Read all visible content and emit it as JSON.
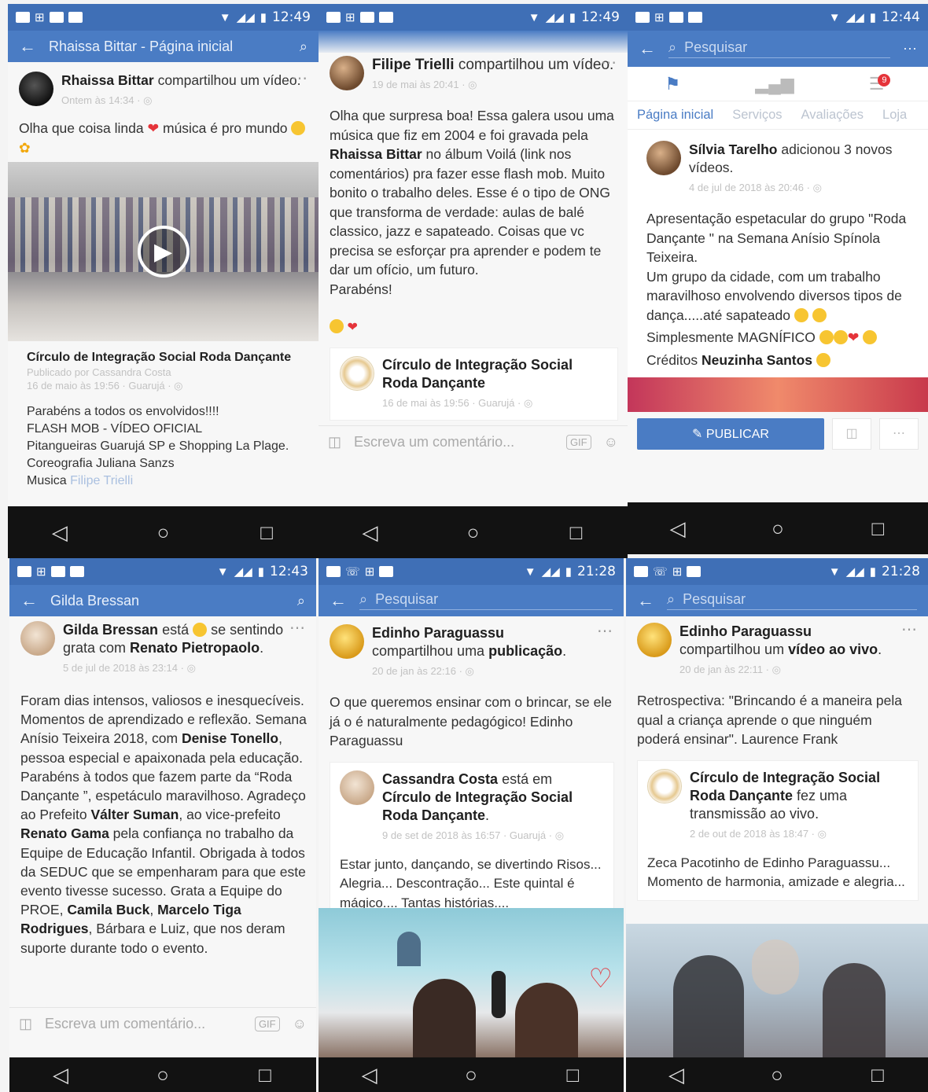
{
  "status": {
    "s1": {
      "time": "12:49",
      "battery": "43"
    },
    "s2": {
      "time": "12:49",
      "battery": "43"
    },
    "s3": {
      "time": "12:44",
      "battery": "46"
    },
    "s4": {
      "time": "12:43",
      "battery": "46"
    },
    "s5": {
      "time": "21:28",
      "battery": "40"
    },
    "s6": {
      "time": "21:28",
      "battery": "40"
    }
  },
  "screen1": {
    "appbar_title": "Rhaissa Bittar - Página inicial",
    "post": {
      "author": "Rhaissa Bittar",
      "action": "compartilhou um vídeo.",
      "time": "Ontem às 14:34 · ",
      "text_a": "Olha que coisa linda ",
      "text_b": " música é pro mundo"
    },
    "shared": {
      "title": "Círculo de Integração Social Roda Dançante",
      "published_by": "Publicado por Cassandra Costa",
      "time": "16 de maio às 19:56 · Guarujá · ",
      "lines": [
        "Parabéns a todos os envolvidos!!!!",
        "FLASH MOB - VÍDEO OFICIAL",
        "Pitangueiras Guarujá SP e Shopping La Plage.",
        "Coreografia Juliana Sanzs"
      ],
      "music_label": "Musica ",
      "music_link": "Filipe Trielli"
    }
  },
  "screen2": {
    "post": {
      "author": "Filipe Trielli",
      "action": "compartilhou um vídeo.",
      "time": "19 de mai às 20:41 · ",
      "text_a": "Olha que surpresa boa! Essa galera usou uma música que fiz em 2004 e foi gravada pela ",
      "text_bold": "Rhaissa Bittar",
      "text_b": " no álbum Voilá (link nos comentários) pra fazer esse flash mob. Muito bonito o trabalho deles. Esse é o tipo de ONG que transforma de verdade: aulas de balé classico, jazz e sapateado. Coisas que vc precisa se esforçar pra aprender e podem te dar um ofício, um futuro.",
      "text_c": "Parabéns!"
    },
    "shared": {
      "title": "Círculo de Integração Social Roda Dançante",
      "time": "16 de mai às 19:56 · Guarujá · "
    },
    "comment_placeholder": "Escreva um comentário...",
    "gif": "GIF"
  },
  "screen3": {
    "search_placeholder": "Pesquisar",
    "badge": "9",
    "tabs": [
      "Página inicial",
      "Serviços",
      "Avaliações",
      "Loja"
    ],
    "post": {
      "author": "Sílvia Tarelho",
      "action": "adicionou 3 novos vídeos.",
      "time": "4 de jul de 2018 às 20:46 · ",
      "p1": "Apresentação espetacular do grupo \"Roda Dançante \" na Semana Anísio Spínola Teixeira.",
      "p2": "Um grupo da cidade, com um trabalho maravilhoso envolvendo diversos tipos de dança.....até  sapateado",
      "p3": "Simplesmente  MAGNÍFICO",
      "credits_label": "Créditos  ",
      "credits_name": "Neuzinha Santos"
    },
    "publish": "PUBLICAR"
  },
  "screen4": {
    "appbar_title": "Gilda Bressan",
    "post": {
      "author": "Gilda Bressan",
      "action_a": "está ",
      "action_b": " se sentindo grata com ",
      "with": "Renato Pietropaolo",
      "time": "5 de jul de 2018 às 23:14 · ",
      "t1": "Foram dias intensos, valiosos e inesquecíveis. Momentos de aprendizado e reflexão. Semana Anísio Teixeira 2018, com ",
      "b1": "Denise Tonello",
      "t2": ", pessoa especial e apaixonada pela educação. Parabéns à todos que fazem parte da “Roda Dançante ”, espetáculo maravilhoso. Agradeço ao Prefeito ",
      "b2": "Válter Suman",
      "t3": ", ao vice-prefeito ",
      "b3": "Renato Gama",
      "t4": " pela confiança no trabalho da Equipe de Educação Infantil. Obrigada à todos da SEDUC que se empenharam para que este evento tivesse sucesso. Grata a Equipe do PROE, ",
      "b4": "Camila Buck",
      "t5": ", ",
      "b5": "Marcelo Tiga Rodrigues",
      "t6": ", Bárbara e Luiz, que nos deram suporte durante todo o evento."
    },
    "comment_placeholder": "Escreva um comentário...",
    "gif": "GIF"
  },
  "screen5": {
    "search_placeholder": "Pesquisar",
    "post": {
      "author": "Edinho Paraguassu",
      "action_a": "compartilhou uma ",
      "action_b": "publicação",
      "action_c": ".",
      "time": "20 de jan às 22:16 · ",
      "text": "O que queremos ensinar com o brincar, se ele já o é naturalmente pedagógico! Edinho Paraguassu"
    },
    "shared": {
      "author": "Cassandra Costa",
      "action": " está em ",
      "place": "Círculo de Integração Social Roda Dançante",
      "time": "9 de set de 2018 às 16:57 · Guarujá · ",
      "text": "Estar junto, dançando, se divertindo Risos... Alegria... Descontração... Este quintal é mágico.... Tantas histórias...."
    }
  },
  "screen6": {
    "search_placeholder": "Pesquisar",
    "post": {
      "author": "Edinho Paraguassu",
      "action_a": "compartilhou um ",
      "action_b": "vídeo ao vivo",
      "action_c": ".",
      "time": "20 de jan às 22:11 · ",
      "text": "Retrospectiva: \"Brincando é a maneira pela qual a criança aprende o que ninguém poderá ensinar\". Laurence Frank"
    },
    "shared": {
      "title": "Círculo de Integração Social Roda Dançante",
      "action": " fez uma transmissão ao vivo.",
      "time": "2 de out de 2018 às 18:47 · ",
      "text": "Zeca Pacotinho de Edinho Paraguassu... Momento de harmonia, amizade e alegria..."
    }
  }
}
